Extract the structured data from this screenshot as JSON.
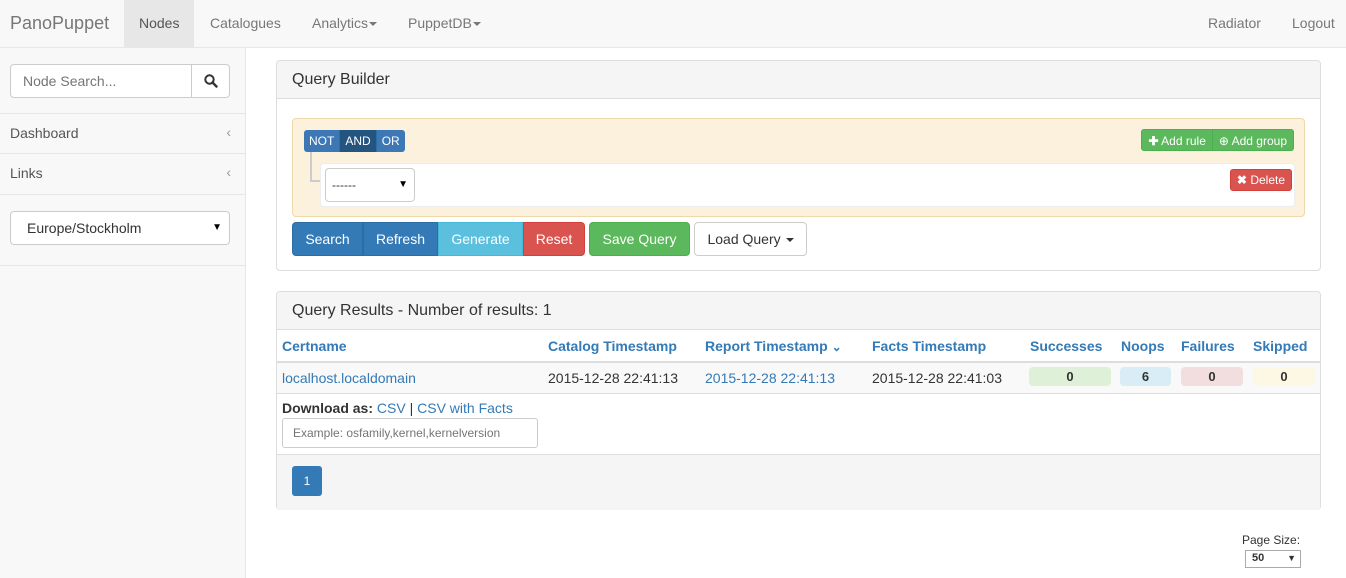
{
  "navbar": {
    "brand": "PanoPuppet",
    "items": [
      {
        "label": "Nodes"
      },
      {
        "label": "Catalogues"
      },
      {
        "label": "Analytics"
      },
      {
        "label": "PuppetDB"
      }
    ],
    "right_items": [
      {
        "label": "Radiator"
      },
      {
        "label": "Logout"
      }
    ]
  },
  "sidebar": {
    "search_placeholder": "Node Search...",
    "links": [
      {
        "label": "Dashboard",
        "chevron": "‹"
      },
      {
        "label": "Links",
        "chevron": "‹"
      }
    ],
    "timezone": "Europe/Stockholm"
  },
  "query_builder": {
    "title": "Query Builder",
    "conditions": [
      "NOT",
      "AND",
      "OR"
    ],
    "add_rule": "Add rule",
    "add_group": "Add group",
    "rule_select": "------",
    "delete": "Delete",
    "buttons": {
      "search": "Search",
      "refresh": "Refresh",
      "generate": "Generate",
      "reset": "Reset",
      "save_query": "Save Query",
      "load_query": "Load Query"
    }
  },
  "results": {
    "title": "Query Results - Number of results: 1",
    "columns": [
      "Certname",
      "Catalog Timestamp",
      "Report Timestamp",
      "Facts Timestamp",
      "Successes",
      "Noops",
      "Failures",
      "Skipped"
    ],
    "rows": [
      {
        "certname": "localhost.localdomain",
        "catalog_timestamp": "2015-12-28 22:41:13",
        "report_timestamp": "2015-12-28 22:41:13",
        "facts_timestamp": "2015-12-28 22:41:03",
        "successes": "0",
        "noops": "6",
        "failures": "0",
        "skipped": "0"
      }
    ],
    "download_label": "Download as:",
    "download_csv": "CSV",
    "download_sep": "|",
    "download_csv_facts": "CSV with Facts",
    "facts_placeholder": "Example: osfamily,kernel,kernelversion",
    "page": "1"
  },
  "page_size": {
    "label": "Page Size:",
    "value": "50"
  },
  "colors": {
    "primary": "#337ab7",
    "success": "#5cb85c",
    "info": "#5bc0de",
    "danger": "#d9534f"
  }
}
